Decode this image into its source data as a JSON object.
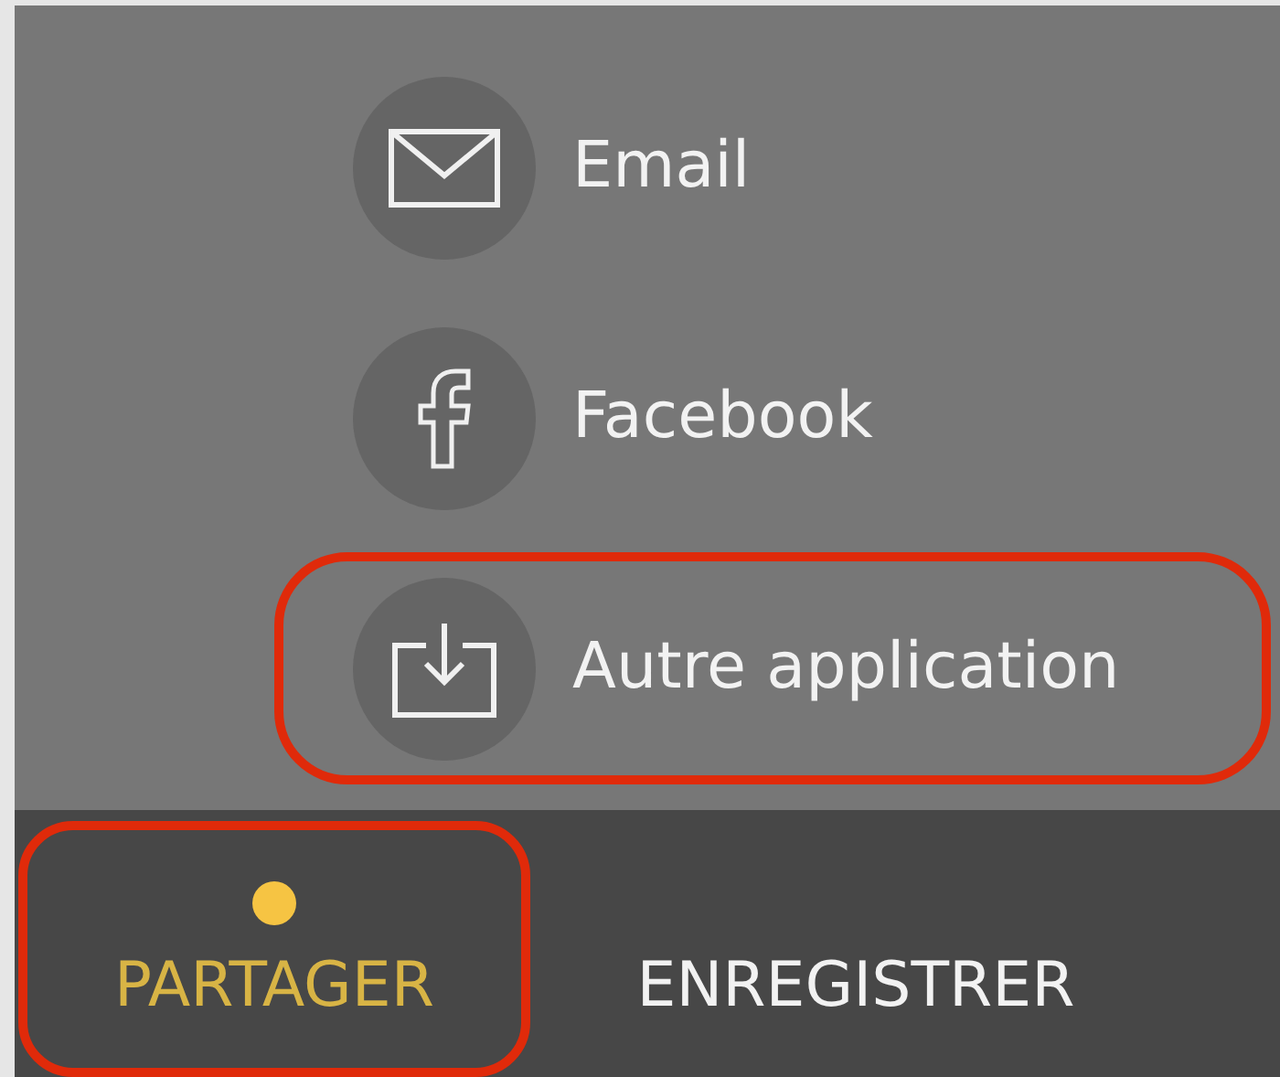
{
  "share_options": [
    {
      "kind": "email",
      "label": "Email",
      "highlighted": false
    },
    {
      "kind": "facebook",
      "label": "Facebook",
      "highlighted": false
    },
    {
      "kind": "other",
      "label": "Autre application",
      "highlighted": true
    }
  ],
  "tabs": [
    {
      "label": "PARTAGER",
      "selected": true,
      "highlighted": true
    },
    {
      "label": "ENREGISTRER",
      "selected": false,
      "highlighted": false
    }
  ]
}
